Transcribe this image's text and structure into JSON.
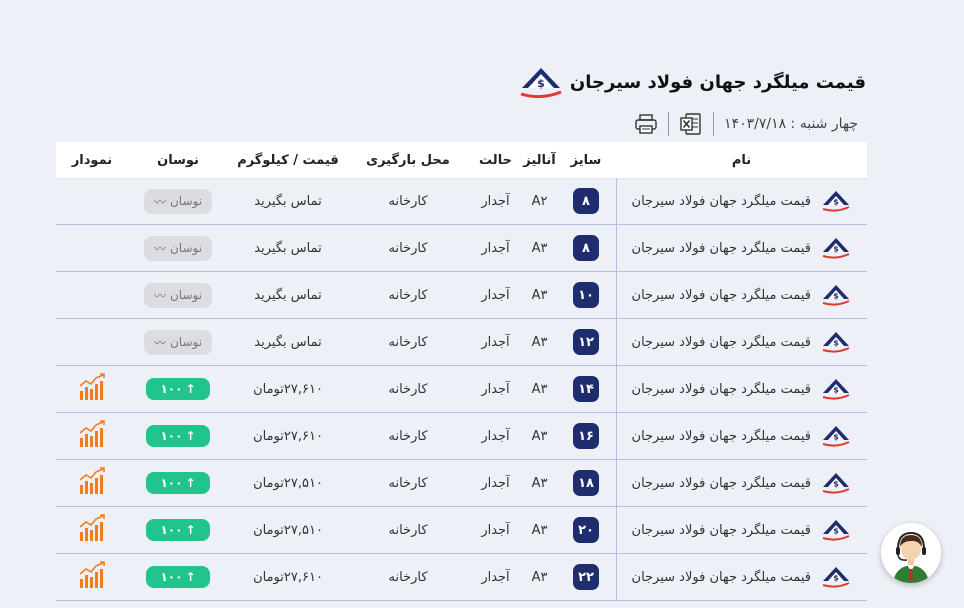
{
  "header": {
    "title": "قیمت میلگرد جهان فولاد سیرجان",
    "date": "چهار شنبه : ۱۴۰۳/۷/۱۸",
    "logo_icon": "jahan-foolad-logo-icon",
    "excel_icon": "excel-export-icon",
    "print_icon": "print-icon"
  },
  "table": {
    "columns": {
      "name": "نام",
      "size": "سایز",
      "analysis": "آنالیز",
      "state": "حالت",
      "place": "محل بارگیری",
      "price": "قیمت / کیلوگرم",
      "change": "نوسان",
      "chart": "نمودار"
    },
    "rows": [
      {
        "name": "قیمت میلگرد جهان فولاد سیرجان",
        "size": "۸",
        "analysis": "A۲",
        "state": "آجدار",
        "place": "کارخانه",
        "price": "تماس بگیرید",
        "change": "نوسان",
        "change_type": "neutral",
        "has_chart": false
      },
      {
        "name": "قیمت میلگرد جهان فولاد سیرجان",
        "size": "۸",
        "analysis": "A۳",
        "state": "آجدار",
        "place": "کارخانه",
        "price": "تماس بگیرید",
        "change": "نوسان",
        "change_type": "neutral",
        "has_chart": false
      },
      {
        "name": "قیمت میلگرد جهان فولاد سیرجان",
        "size": "۱۰",
        "analysis": "A۳",
        "state": "آجدار",
        "place": "کارخانه",
        "price": "تماس بگیرید",
        "change": "نوسان",
        "change_type": "neutral",
        "has_chart": false
      },
      {
        "name": "قیمت میلگرد جهان فولاد سیرجان",
        "size": "۱۲",
        "analysis": "A۳",
        "state": "آجدار",
        "place": "کارخانه",
        "price": "تماس بگیرید",
        "change": "نوسان",
        "change_type": "neutral",
        "has_chart": false
      },
      {
        "name": "قیمت میلگرد جهان فولاد سیرجان",
        "size": "۱۴",
        "analysis": "A۳",
        "state": "آجدار",
        "place": "کارخانه",
        "price": "۲۷,۶۱۰تومان",
        "change": "۱۰۰",
        "change_type": "up",
        "has_chart": true
      },
      {
        "name": "قیمت میلگرد جهان فولاد سیرجان",
        "size": "۱۶",
        "analysis": "A۳",
        "state": "آجدار",
        "place": "کارخانه",
        "price": "۲۷,۶۱۰تومان",
        "change": "۱۰۰",
        "change_type": "up",
        "has_chart": true
      },
      {
        "name": "قیمت میلگرد جهان فولاد سیرجان",
        "size": "۱۸",
        "analysis": "A۳",
        "state": "آجدار",
        "place": "کارخانه",
        "price": "۲۷,۵۱۰تومان",
        "change": "۱۰۰",
        "change_type": "up",
        "has_chart": true
      },
      {
        "name": "قیمت میلگرد جهان فولاد سیرجان",
        "size": "۲۰",
        "analysis": "A۳",
        "state": "آجدار",
        "place": "کارخانه",
        "price": "۲۷,۵۱۰تومان",
        "change": "۱۰۰",
        "change_type": "up",
        "has_chart": true
      },
      {
        "name": "قیمت میلگرد جهان فولاد سیرجان",
        "size": "۲۲",
        "analysis": "A۳",
        "state": "آجدار",
        "place": "کارخانه",
        "price": "۲۷,۶۱۰تومان",
        "change": "۱۰۰",
        "change_type": "up",
        "has_chart": true
      }
    ]
  },
  "support": {
    "icon": "support-agent-icon"
  },
  "colors": {
    "background": "#eef0f8",
    "size_badge": "#1f2d6e",
    "up_pill": "#21c48c",
    "neutral_pill": "#dcdde2",
    "row_border": "#b8bde3",
    "chart_icon": "#f07d1a"
  }
}
